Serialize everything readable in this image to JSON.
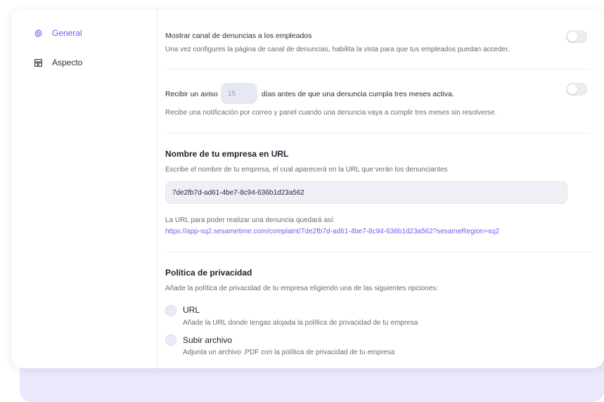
{
  "sidebar": {
    "items": [
      {
        "label": "General",
        "icon": "gear-icon",
        "active": true
      },
      {
        "label": "Aspecto",
        "icon": "layout-icon",
        "active": false
      }
    ]
  },
  "settings": {
    "show_channel": {
      "title": "Mostrar canal de denuncias a los empleados",
      "description": "Una vez configures la página de canal de denuncias, habilita la vista para que tus empleados puedan acceder.",
      "enabled": false
    },
    "reminder": {
      "prefix": "Recibir un aviso",
      "days_value": "15",
      "suffix": "días antes de que una denuncia cumpla tres meses activa.",
      "description": "Recibe una notificación por correo y panel cuando una denuncia vaya a cumplir tres meses sin resolverse.",
      "enabled": false
    },
    "company_url": {
      "title": "Nombre de tu empresa en URL",
      "description": "Escribe el nombre de tu empresa, el cual aparecerá en la URL que verán los denunciantes",
      "value": "7de2fb7d-ad61-4be7-8c94-636b1d23a562",
      "result_label": "La URL para poder realizar una denuncia quedará así:",
      "result_url": "https://app-sq2.sesametime.com/complaint/7de2fb7d-ad61-4be7-8c94-636b1d23a562?sesameRegion=sq2"
    },
    "privacy": {
      "title": "Política de privacidad",
      "description": "Añade la política de privacidad de tu empresa eligiendo una de las siguientes opciones:",
      "options": [
        {
          "label": "URL",
          "description": "Añade la URL donde tengas alojada la política de privacidad de tu empresa"
        },
        {
          "label": "Subir archivo",
          "description": "Adjunta un archivo .PDF con la política de privacidad de tu empresa"
        }
      ]
    }
  },
  "colors": {
    "accent": "#6d5ff0",
    "backdrop": "#ebe8fc"
  }
}
